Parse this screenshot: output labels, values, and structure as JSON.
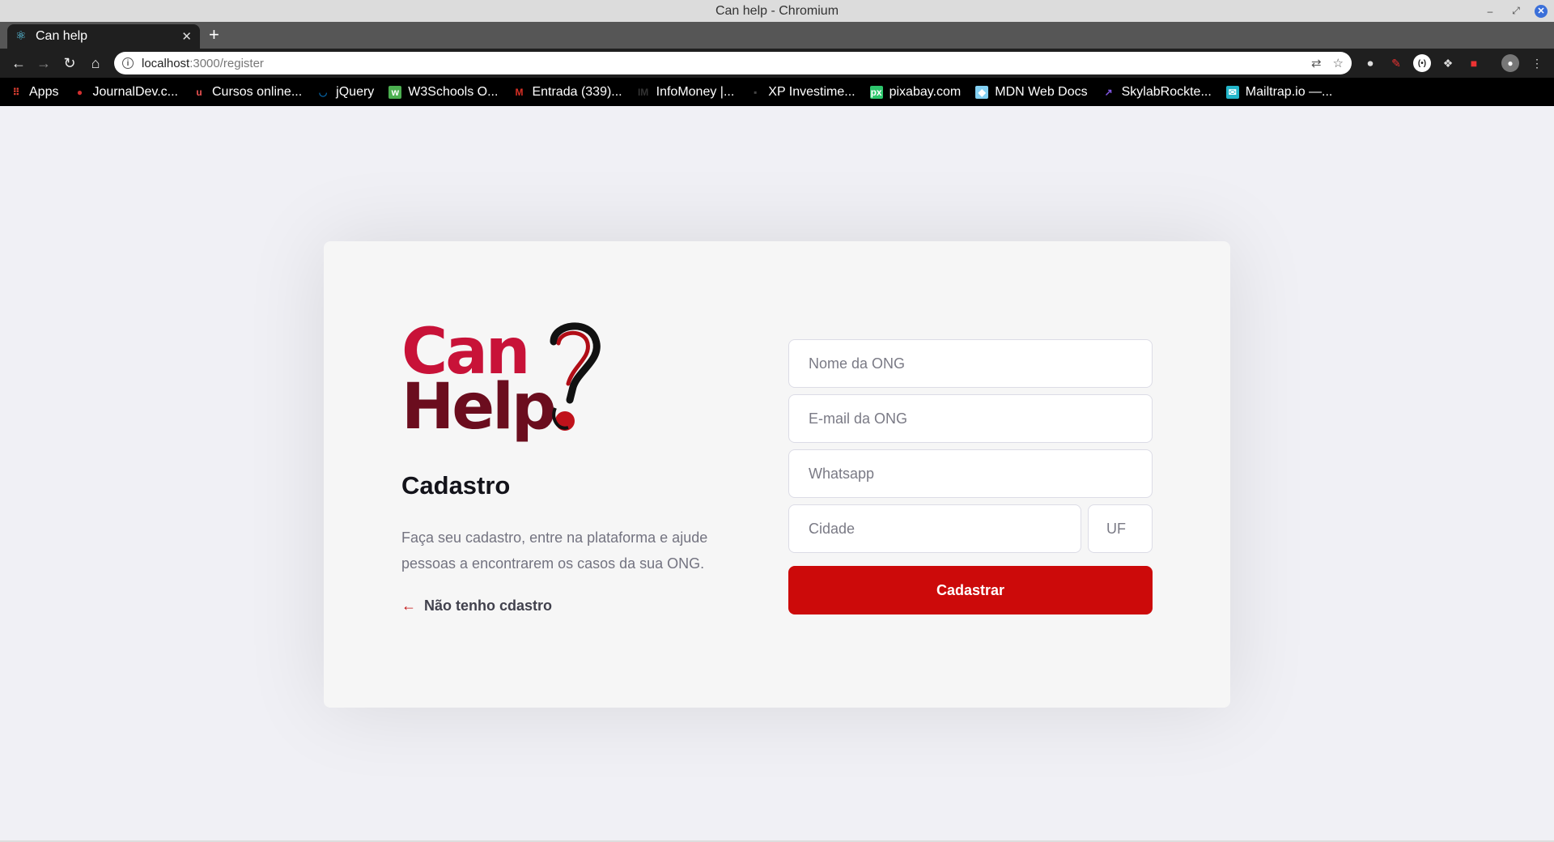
{
  "window": {
    "title": "Can help - Chromium"
  },
  "tabs": [
    {
      "title": "Can help",
      "icon": "react-icon"
    }
  ],
  "address_bar": {
    "host": "localhost",
    "path": ":3000/register"
  },
  "bookmarks": [
    {
      "label": "Apps",
      "icon": "apps-grid-icon",
      "color": "#e94235"
    },
    {
      "label": "JournalDev.c...",
      "icon": "journaldev-icon",
      "color": "#d32f2f"
    },
    {
      "label": "Cursos online...",
      "icon": "udemy-icon",
      "color": "#ec5252"
    },
    {
      "label": "jQuery",
      "icon": "jquery-icon",
      "color": "#0769ad"
    },
    {
      "label": "W3Schools O...",
      "icon": "w3schools-icon",
      "color": "#4caf50"
    },
    {
      "label": "Entrada (339)...",
      "icon": "gmail-icon",
      "color": "#d93025"
    },
    {
      "label": "InfoMoney |...",
      "icon": "infomoney-icon",
      "color": "#333333"
    },
    {
      "label": "XP Investime...",
      "icon": "xp-icon",
      "color": "#444444"
    },
    {
      "label": "pixabay.com",
      "icon": "pixabay-icon",
      "color": "#2ec66d"
    },
    {
      "label": "MDN Web Docs",
      "icon": "mdn-icon",
      "color": "#83d0f2"
    },
    {
      "label": "SkylabRockte...",
      "icon": "rocketseat-icon",
      "color": "#8257e5"
    },
    {
      "label": "Mailtrap.io —...",
      "icon": "mailtrap-icon",
      "color": "#22b5c9"
    }
  ],
  "page": {
    "logo": {
      "word1": "Can",
      "word2": "Help"
    },
    "title": "Cadastro",
    "description": "Faça seu cadastro, entre na plataforma e ajude pessoas a encontrarem os casos da sua ONG.",
    "back_link": "Não tenho cdastro",
    "form": {
      "name_placeholder": "Nome da ONG",
      "email_placeholder": "E-mail da ONG",
      "whatsapp_placeholder": "Whatsapp",
      "city_placeholder": "Cidade",
      "uf_placeholder": "UF",
      "submit_label": "Cadastrar"
    },
    "colors": {
      "accent": "#cc0a0a",
      "logo_red": "#c81238",
      "logo_dark": "#6b0d1e"
    }
  }
}
